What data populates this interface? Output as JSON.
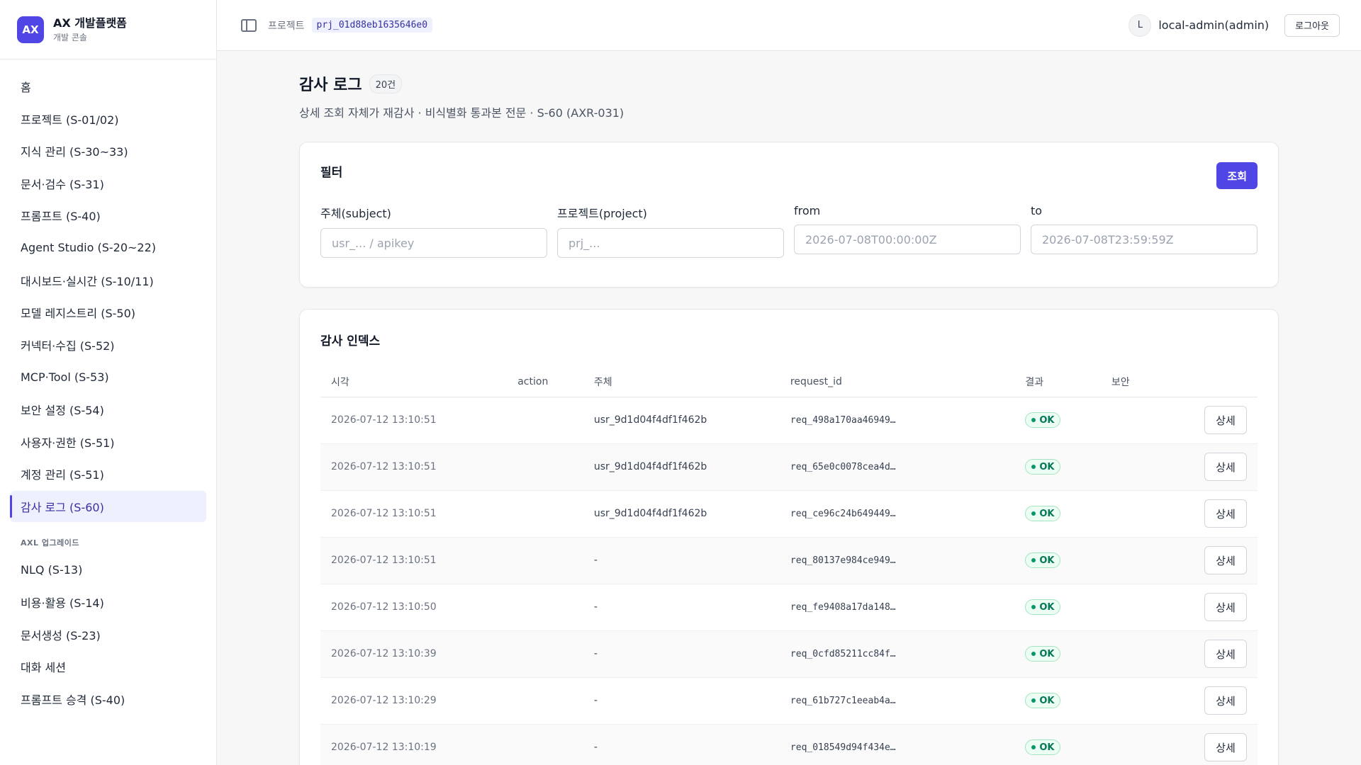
{
  "brand": {
    "logo": "AX",
    "name": "AX 개발플랫폼",
    "subtitle": "개발 콘솔"
  },
  "sidebar": {
    "items": [
      {
        "label": "홈"
      },
      {
        "label": "프로젝트 (S-01/02)"
      },
      {
        "label": "지식 관리 (S-30~33)"
      },
      {
        "label": "문서·검수 (S-31)"
      },
      {
        "label": "프롬프트 (S-40)"
      },
      {
        "label": "Agent Studio (S-20~22)"
      },
      {
        "label": "대시보드·실시간 (S-10/11)"
      },
      {
        "label": "모델 레지스트리 (S-50)"
      },
      {
        "label": "커넥터·수집 (S-52)"
      },
      {
        "label": "MCP·Tool (S-53)"
      },
      {
        "label": "보안 설정 (S-54)"
      },
      {
        "label": "사용자·권한 (S-51)"
      },
      {
        "label": "계정 관리 (S-51)"
      },
      {
        "label": "감사 로그 (S-60)"
      }
    ],
    "section_label": "AXL 업그레이드",
    "section_items": [
      {
        "label": "NLQ (S-13)"
      },
      {
        "label": "비용·활용 (S-14)"
      },
      {
        "label": "문서생성 (S-23)"
      },
      {
        "label": "대화 세션"
      },
      {
        "label": "프롬프트 승격 (S-40)"
      }
    ]
  },
  "topbar": {
    "project_label": "프로젝트",
    "project_id": "prj_01d88eb1635646e0",
    "avatar_initial": "L",
    "user_name": "local-admin(admin)",
    "logout_label": "로그아웃"
  },
  "page": {
    "title": "감사 로그",
    "count_badge": "20건",
    "subtitle": "상세 조회 자체가 재감사 · 비식별화 통과본 전문 · S-60 (AXR-031)"
  },
  "filter": {
    "title": "필터",
    "search_label": "조회",
    "fields": [
      {
        "label": "주체(subject)",
        "placeholder": "usr_... / apikey"
      },
      {
        "label": "프로젝트(project)",
        "placeholder": "prj_..."
      },
      {
        "label": "from",
        "placeholder": "2026-07-08T00:00:00Z"
      },
      {
        "label": "to",
        "placeholder": "2026-07-08T23:59:59Z"
      }
    ]
  },
  "audit": {
    "title": "감사 인덱스",
    "columns": [
      "시각",
      "action",
      "주체",
      "request_id",
      "결과",
      "보안"
    ],
    "detail_label": "상세",
    "rows": [
      {
        "time": "2026-07-12 13:10:51",
        "action": "",
        "subject": "usr_9d1d04f4df1f462b",
        "request_id": "req_498a170aa46949…",
        "result": "OK",
        "security": ""
      },
      {
        "time": "2026-07-12 13:10:51",
        "action": "",
        "subject": "usr_9d1d04f4df1f462b",
        "request_id": "req_65e0c0078cea4d…",
        "result": "OK",
        "security": ""
      },
      {
        "time": "2026-07-12 13:10:51",
        "action": "",
        "subject": "usr_9d1d04f4df1f462b",
        "request_id": "req_ce96c24b649449…",
        "result": "OK",
        "security": ""
      },
      {
        "time": "2026-07-12 13:10:51",
        "action": "",
        "subject": "-",
        "request_id": "req_80137e984ce949…",
        "result": "OK",
        "security": ""
      },
      {
        "time": "2026-07-12 13:10:50",
        "action": "",
        "subject": "-",
        "request_id": "req_fe9408a17da148…",
        "result": "OK",
        "security": ""
      },
      {
        "time": "2026-07-12 13:10:39",
        "action": "",
        "subject": "-",
        "request_id": "req_0cfd85211cc84f…",
        "result": "OK",
        "security": ""
      },
      {
        "time": "2026-07-12 13:10:29",
        "action": "",
        "subject": "-",
        "request_id": "req_61b727c1eeab4a…",
        "result": "OK",
        "security": ""
      },
      {
        "time": "2026-07-12 13:10:19",
        "action": "",
        "subject": "-",
        "request_id": "req_018549d94f434e…",
        "result": "OK",
        "security": ""
      }
    ]
  },
  "colors": {
    "accent": "#4f46e5",
    "ok": "#047857"
  }
}
